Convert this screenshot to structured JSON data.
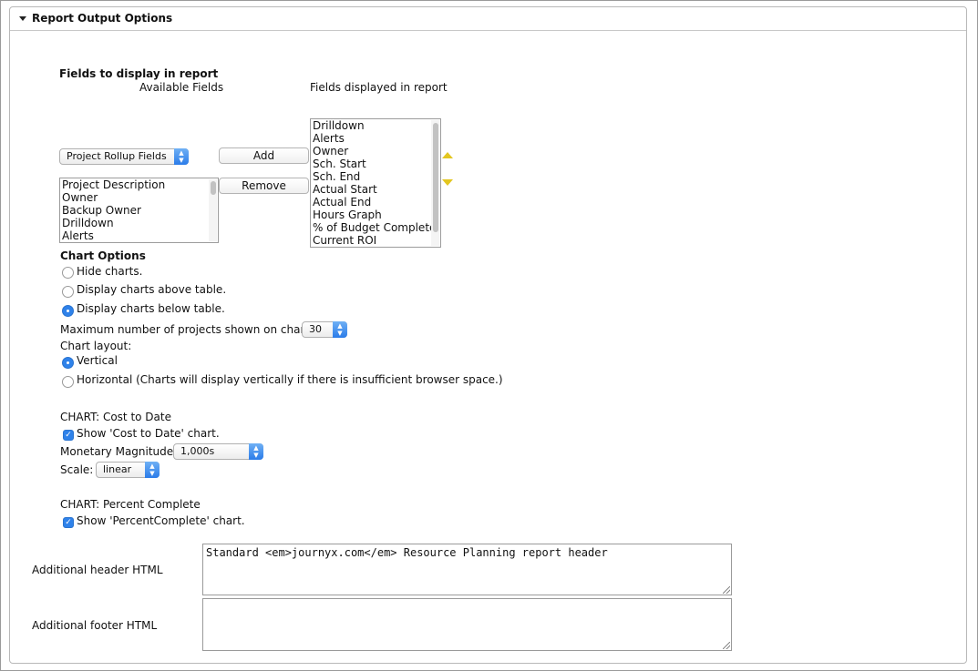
{
  "panel": {
    "title": "Report Output Options"
  },
  "fields": {
    "heading": "Fields to display in report",
    "available_label": "Available Fields",
    "displayed_label": "Fields displayed in report",
    "dropdown_value": "Project Rollup Fields",
    "add_label": "Add",
    "remove_label": "Remove",
    "available_items": [
      "Project Description",
      "Owner",
      "Backup Owner",
      "Drilldown",
      "Alerts"
    ],
    "displayed_items": [
      "Drilldown",
      "Alerts",
      "Owner",
      "Sch. Start",
      "Sch. End",
      "Actual Start",
      "Actual End",
      "Hours Graph",
      "% of Budget Complete",
      "Current ROI"
    ]
  },
  "chart_options": {
    "heading": "Chart Options",
    "hide": "Hide charts.",
    "above": "Display charts above table.",
    "below": "Display charts below table.",
    "max_label": "Maximum number of projects shown on chart:",
    "max_value": "30",
    "layout_label": "Chart layout:",
    "vertical": "Vertical",
    "horizontal": "Horizontal (Charts will display vertically if there is insufficient browser space.)"
  },
  "cost_chart": {
    "heading": "CHART: Cost to Date",
    "show_label": "Show 'Cost to Date' chart.",
    "magnitude_label": "Monetary Magnitude:",
    "magnitude_value": "1,000s",
    "scale_label": "Scale:",
    "scale_value": "linear"
  },
  "percent_chart": {
    "heading": "CHART: Percent Complete",
    "show_label": "Show 'PercentComplete' chart."
  },
  "html_fields": {
    "header_label": "Additional header HTML",
    "header_value": "Standard <em>journyx.com</em> Resource Planning report header",
    "footer_label": "Additional footer HTML",
    "footer_value": ""
  },
  "colors": {
    "accent": "#2f82ea",
    "arrow": "#e3c620"
  }
}
